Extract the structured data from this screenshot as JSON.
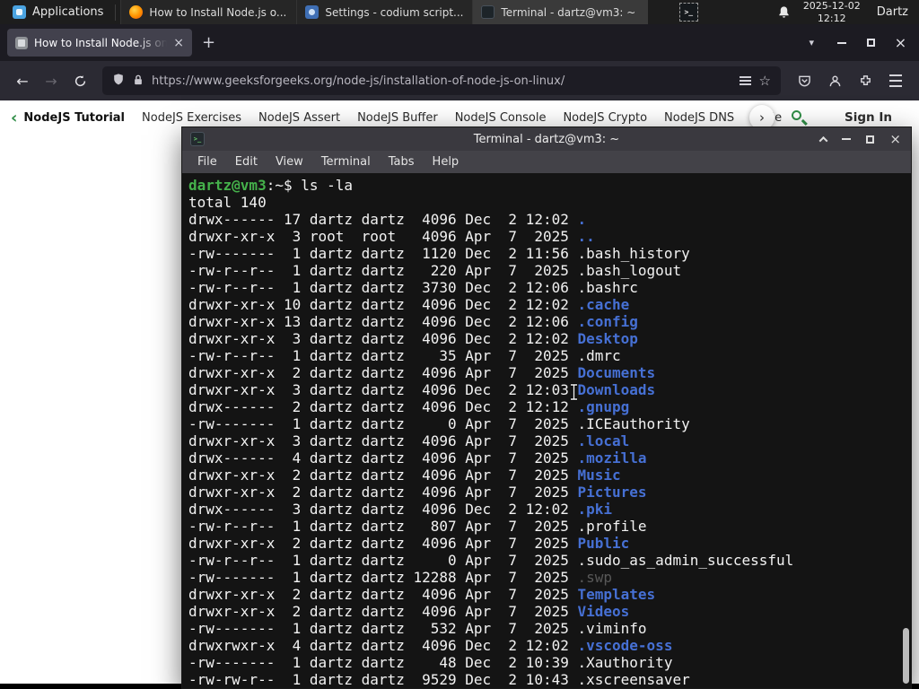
{
  "panel": {
    "applications_label": "Applications",
    "tray_glyph": ">_",
    "tasks": [
      {
        "title": "How to Install Node.js o...",
        "icon": "firefox-icon",
        "active": false
      },
      {
        "title": "Settings - codium script...",
        "icon": "settings-icon",
        "active": false
      },
      {
        "title": "Terminal - dartz@vm3: ~",
        "icon": "terminal-icon",
        "active": true
      }
    ],
    "clock_date": "2025-12-02",
    "clock_time": "12:12",
    "user": "Dartz"
  },
  "browser": {
    "tab_title": "How to Install Node.js on",
    "url": "https://www.geeksforgeeks.org/node-js/installation-of-node-js-on-linux/",
    "glyphs": {
      "close": "×",
      "new_tab": "+",
      "tab_chevron": "▾",
      "back": "←",
      "forward": "→",
      "star": "☆"
    }
  },
  "site_nav": {
    "back_chevron": "‹",
    "scroll_chevron": "›",
    "sign_in": "Sign In",
    "items": [
      {
        "label": "NodeJS Tutorial",
        "bold": true
      },
      {
        "label": "NodeJS Exercises",
        "bold": false
      },
      {
        "label": "NodeJS Assert",
        "bold": false
      },
      {
        "label": "NodeJS Buffer",
        "bold": false
      },
      {
        "label": "NodeJS Console",
        "bold": false
      },
      {
        "label": "NodeJS Crypto",
        "bold": false
      },
      {
        "label": "NodeJS DNS",
        "bold": false
      },
      {
        "label": "Node",
        "bold": false
      }
    ]
  },
  "terminal": {
    "window_title": "Terminal - dartz@vm3: ~",
    "icon_glyph": ">_",
    "menu": [
      "File",
      "Edit",
      "View",
      "Terminal",
      "Tabs",
      "Help"
    ],
    "prompt_user_host": "dartz@vm3",
    "prompt_suffix": ":~$",
    "command": "ls -la",
    "total_line": "total 140",
    "colors": {
      "prompt": "#45b14b",
      "fg": "#f2f2f2",
      "dir": "#4670d4",
      "file": "#f2f2f2",
      "dim": "#585858"
    },
    "listing": [
      {
        "meta": "drwx------ 17 dartz dartz  4096 Dec  2 12:02 ",
        "name": ".",
        "type": "dir"
      },
      {
        "meta": "drwxr-xr-x  3 root  root   4096 Apr  7  2025 ",
        "name": "..",
        "type": "dir"
      },
      {
        "meta": "-rw-------  1 dartz dartz  1120 Dec  2 11:56 ",
        "name": ".bash_history",
        "type": "file"
      },
      {
        "meta": "-rw-r--r--  1 dartz dartz   220 Apr  7  2025 ",
        "name": ".bash_logout",
        "type": "file"
      },
      {
        "meta": "-rw-r--r--  1 dartz dartz  3730 Dec  2 12:06 ",
        "name": ".bashrc",
        "type": "file"
      },
      {
        "meta": "drwxr-xr-x 10 dartz dartz  4096 Dec  2 12:02 ",
        "name": ".cache",
        "type": "dir"
      },
      {
        "meta": "drwxr-xr-x 13 dartz dartz  4096 Dec  2 12:06 ",
        "name": ".config",
        "type": "dir"
      },
      {
        "meta": "drwxr-xr-x  3 dartz dartz  4096 Dec  2 12:02 ",
        "name": "Desktop",
        "type": "dir"
      },
      {
        "meta": "-rw-r--r--  1 dartz dartz    35 Apr  7  2025 ",
        "name": ".dmrc",
        "type": "file"
      },
      {
        "meta": "drwxr-xr-x  2 dartz dartz  4096 Apr  7  2025 ",
        "name": "Documents",
        "type": "dir"
      },
      {
        "meta": "drwxr-xr-x  3 dartz dartz  4096 Dec  2 12:03 ",
        "name": "Downloads",
        "type": "dir"
      },
      {
        "meta": "drwx------  2 dartz dartz  4096 Dec  2 12:12 ",
        "name": ".gnupg",
        "type": "dir"
      },
      {
        "meta": "-rw-------  1 dartz dartz     0 Apr  7  2025 ",
        "name": ".ICEauthority",
        "type": "file"
      },
      {
        "meta": "drwxr-xr-x  3 dartz dartz  4096 Apr  7  2025 ",
        "name": ".local",
        "type": "dir"
      },
      {
        "meta": "drwx------  4 dartz dartz  4096 Apr  7  2025 ",
        "name": ".mozilla",
        "type": "dir"
      },
      {
        "meta": "drwxr-xr-x  2 dartz dartz  4096 Apr  7  2025 ",
        "name": "Music",
        "type": "dir"
      },
      {
        "meta": "drwxr-xr-x  2 dartz dartz  4096 Apr  7  2025 ",
        "name": "Pictures",
        "type": "dir"
      },
      {
        "meta": "drwx------  3 dartz dartz  4096 Dec  2 12:02 ",
        "name": ".pki",
        "type": "dir"
      },
      {
        "meta": "-rw-r--r--  1 dartz dartz   807 Apr  7  2025 ",
        "name": ".profile",
        "type": "file"
      },
      {
        "meta": "drwxr-xr-x  2 dartz dartz  4096 Apr  7  2025 ",
        "name": "Public",
        "type": "dir"
      },
      {
        "meta": "-rw-r--r--  1 dartz dartz     0 Apr  7  2025 ",
        "name": ".sudo_as_admin_successful",
        "type": "file"
      },
      {
        "meta": "-rw-------  1 dartz dartz 12288 Apr  7  2025 ",
        "name": ".swp",
        "type": "dim"
      },
      {
        "meta": "drwxr-xr-x  2 dartz dartz  4096 Apr  7  2025 ",
        "name": "Templates",
        "type": "dir"
      },
      {
        "meta": "drwxr-xr-x  2 dartz dartz  4096 Apr  7  2025 ",
        "name": "Videos",
        "type": "dir"
      },
      {
        "meta": "-rw-------  1 dartz dartz   532 Apr  7  2025 ",
        "name": ".viminfo",
        "type": "file"
      },
      {
        "meta": "drwxrwxr-x  4 dartz dartz  4096 Dec  2 12:02 ",
        "name": ".vscode-oss",
        "type": "dir"
      },
      {
        "meta": "-rw-------  1 dartz dartz    48 Dec  2 10:39 ",
        "name": ".Xauthority",
        "type": "file"
      },
      {
        "meta": "-rw-rw-r--  1 dartz dartz  9529 Dec  2 10:43 ",
        "name": ".xscreensaver",
        "type": "file"
      }
    ]
  }
}
